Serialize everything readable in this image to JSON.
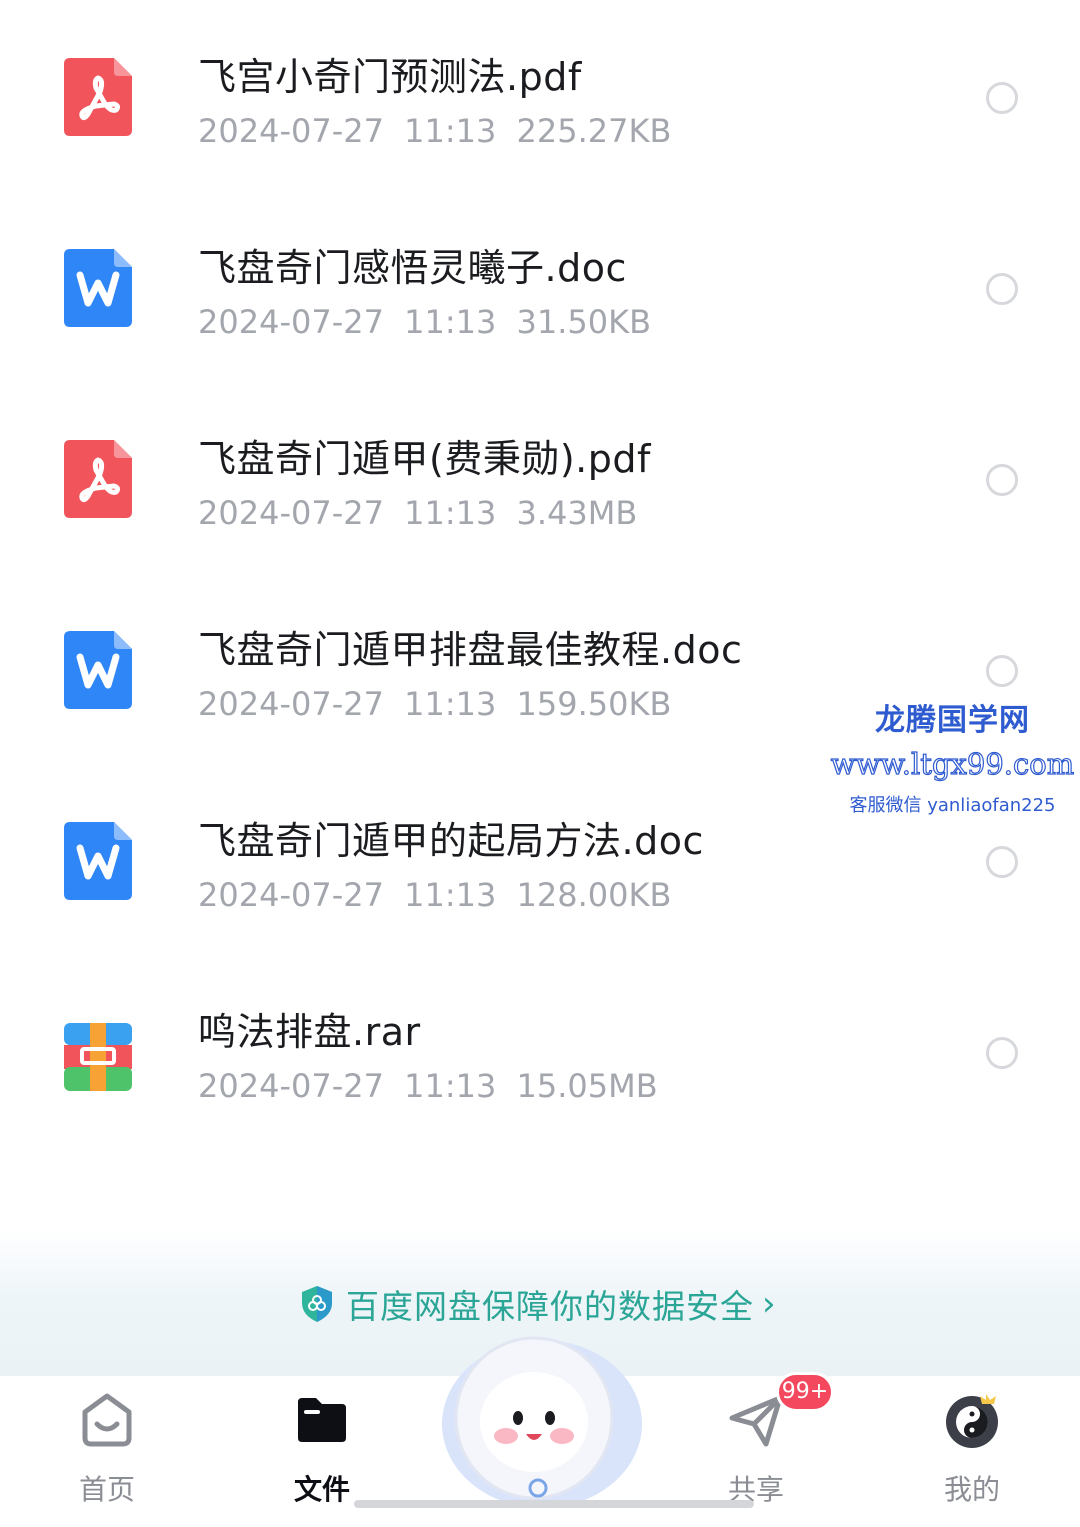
{
  "files": [
    {
      "type": "pdf",
      "name": "飞宫小奇门预测法.pdf",
      "date": "2024-07-27",
      "time": "11:13",
      "size": "225.27KB"
    },
    {
      "type": "doc",
      "name": "飞盘奇门感悟灵曦子.doc",
      "date": "2024-07-27",
      "time": "11:13",
      "size": "31.50KB"
    },
    {
      "type": "pdf",
      "name": "飞盘奇门遁甲(费秉勋).pdf",
      "date": "2024-07-27",
      "time": "11:13",
      "size": "3.43MB"
    },
    {
      "type": "doc",
      "name": "飞盘奇门遁甲排盘最佳教程.doc",
      "date": "2024-07-27",
      "time": "11:13",
      "size": "159.50KB"
    },
    {
      "type": "doc",
      "name": "飞盘奇门遁甲的起局方法.doc",
      "date": "2024-07-27",
      "time": "11:13",
      "size": "128.00KB"
    },
    {
      "type": "rar",
      "name": "鸣法排盘.rar",
      "date": "2024-07-27",
      "time": "11:13",
      "size": "15.05MB"
    }
  ],
  "watermark": {
    "title": "龙腾国学网",
    "url": "www.ltgx99.com",
    "contact": "客服微信 yanliaofan225"
  },
  "security_banner": {
    "text": "百度网盘保障你的数据安全",
    "icon": "shield-icon"
  },
  "tabs": [
    {
      "label": "首页",
      "icon": "home-icon",
      "active": false
    },
    {
      "label": "文件",
      "icon": "folder-icon",
      "active": true
    },
    {
      "label": "共享",
      "icon": "paper-plane-icon",
      "active": false,
      "badge": "99+"
    },
    {
      "label": "我的",
      "icon": "avatar-icon",
      "active": false
    }
  ],
  "colors": {
    "pdf": "#f2545b",
    "doc": "#2f86f6",
    "accent": "#2aa596",
    "badge": "#f3485d"
  }
}
